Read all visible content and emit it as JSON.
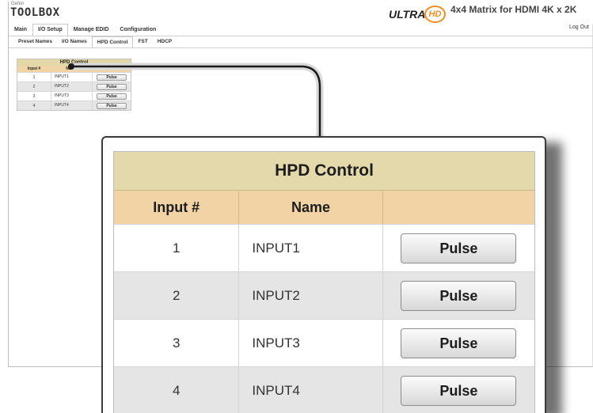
{
  "brand": {
    "logo_small": "Gefen",
    "logo_main": "TOOLBOX",
    "ultra": "ULTRA",
    "hd": "HD",
    "product_title": "4x4 Matrix for HDMI 4K x 2K",
    "logout": "Log Out"
  },
  "main_tabs": [
    {
      "label": "Main",
      "active": false
    },
    {
      "label": "I/O Setup",
      "active": true
    },
    {
      "label": "Manage EDID",
      "active": false
    },
    {
      "label": "Configuration",
      "active": false
    }
  ],
  "sub_tabs": [
    {
      "label": "Preset Names",
      "active": false
    },
    {
      "label": "I/O Names",
      "active": false
    },
    {
      "label": "HPD Control",
      "active": true
    },
    {
      "label": "FST",
      "active": false
    },
    {
      "label": "HDCP",
      "active": false
    }
  ],
  "hpd_table": {
    "title": "HPD Control",
    "columns": [
      "Input #",
      "Name",
      ""
    ],
    "rows": [
      {
        "input": "1",
        "name": "INPUT1",
        "button": "Pulse"
      },
      {
        "input": "2",
        "name": "INPUT2",
        "button": "Pulse"
      },
      {
        "input": "3",
        "name": "INPUT3",
        "button": "Pulse"
      },
      {
        "input": "4",
        "name": "INPUT4",
        "button": "Pulse"
      }
    ]
  },
  "colors": {
    "title_bg": "#e4d9ab",
    "header_bg": "#f1d3a6",
    "alt_row": "#e5e5e5",
    "accent_orange": "#f28c1d"
  }
}
